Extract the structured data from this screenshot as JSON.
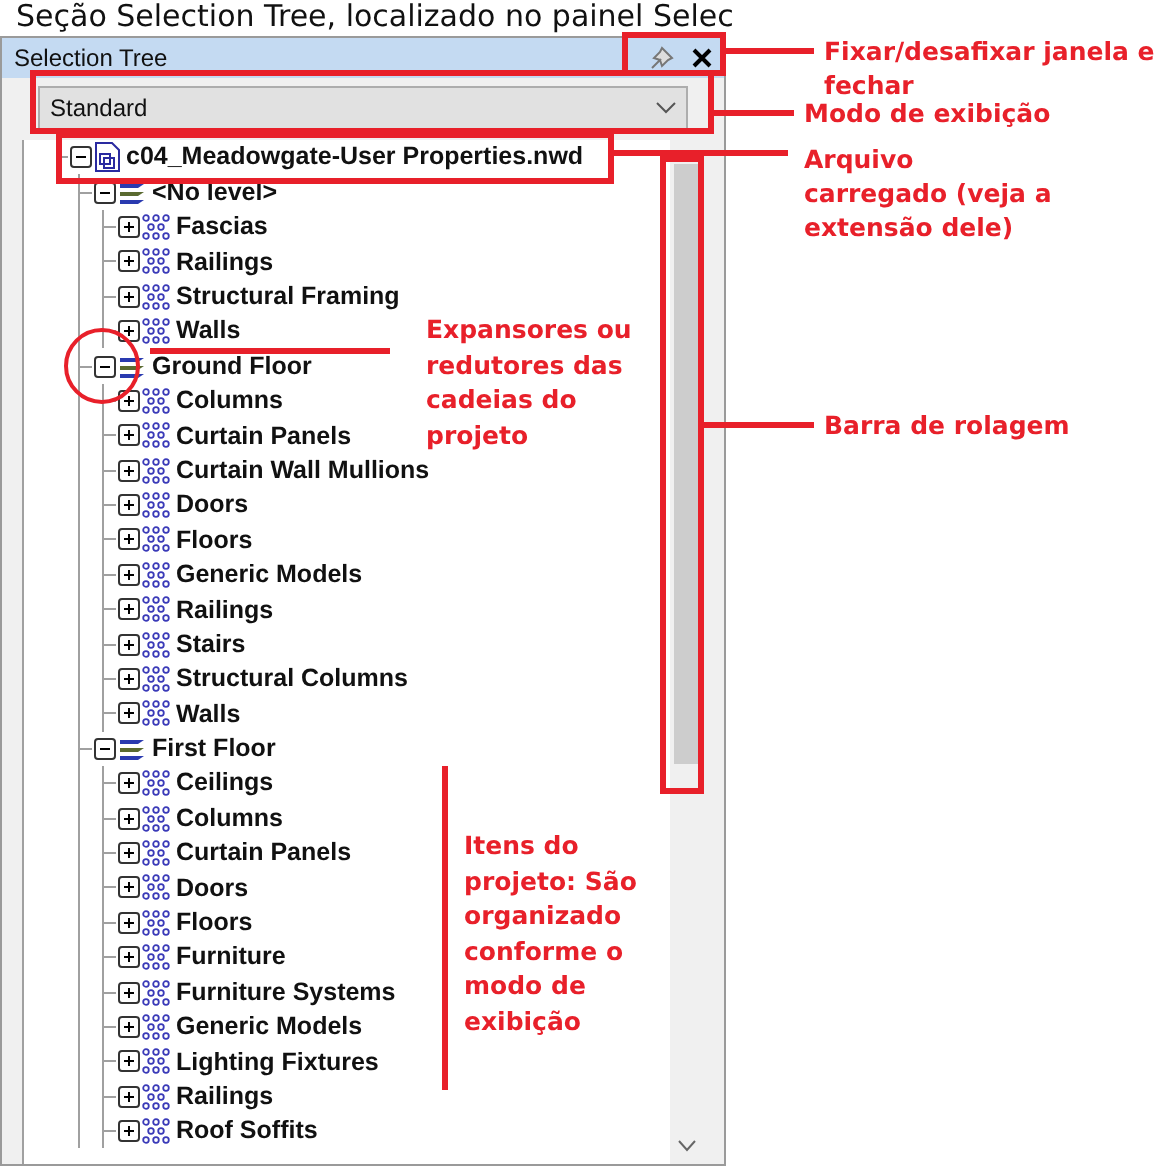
{
  "caption": "Seção Selection Tree, localizado no painel Selec",
  "panel": {
    "title": "Selection Tree",
    "dropdown": {
      "value": "Standard"
    },
    "tree": [
      {
        "label": "c04_Meadowgate-User Properties.nwd",
        "kind": "file",
        "expanded": true,
        "children": [
          {
            "label": "<No level>",
            "kind": "level",
            "expanded": true,
            "children": [
              {
                "label": "Fascias",
                "kind": "category",
                "expanded": false
              },
              {
                "label": "Railings",
                "kind": "category",
                "expanded": false
              },
              {
                "label": "Structural Framing",
                "kind": "category",
                "expanded": false
              },
              {
                "label": "Walls",
                "kind": "category",
                "expanded": false
              }
            ]
          },
          {
            "label": "Ground Floor",
            "kind": "level",
            "expanded": true,
            "children": [
              {
                "label": "Columns",
                "kind": "category",
                "expanded": false
              },
              {
                "label": "Curtain Panels",
                "kind": "category",
                "expanded": false
              },
              {
                "label": "Curtain Wall Mullions",
                "kind": "category",
                "expanded": false
              },
              {
                "label": "Doors",
                "kind": "category",
                "expanded": false
              },
              {
                "label": "Floors",
                "kind": "category",
                "expanded": false
              },
              {
                "label": "Generic Models",
                "kind": "category",
                "expanded": false
              },
              {
                "label": "Railings",
                "kind": "category",
                "expanded": false
              },
              {
                "label": "Stairs",
                "kind": "category",
                "expanded": false
              },
              {
                "label": "Structural Columns",
                "kind": "category",
                "expanded": false
              },
              {
                "label": "Walls",
                "kind": "category",
                "expanded": false
              }
            ]
          },
          {
            "label": "First Floor",
            "kind": "level",
            "expanded": true,
            "children": [
              {
                "label": "Ceilings",
                "kind": "category",
                "expanded": false
              },
              {
                "label": "Columns",
                "kind": "category",
                "expanded": false
              },
              {
                "label": "Curtain Panels",
                "kind": "category",
                "expanded": false
              },
              {
                "label": "Doors",
                "kind": "category",
                "expanded": false
              },
              {
                "label": "Floors",
                "kind": "category",
                "expanded": false
              },
              {
                "label": "Furniture",
                "kind": "category",
                "expanded": false
              },
              {
                "label": "Furniture Systems",
                "kind": "category",
                "expanded": false
              },
              {
                "label": "Generic Models",
                "kind": "category",
                "expanded": false
              },
              {
                "label": "Lighting Fixtures",
                "kind": "category",
                "expanded": false
              },
              {
                "label": "Railings",
                "kind": "category",
                "expanded": false
              },
              {
                "label": "Roof Soffits",
                "kind": "category",
                "expanded": false
              }
            ]
          }
        ]
      }
    ]
  },
  "annotations": [
    "Fixar/desafixar janela e fechar",
    "Modo de exibição",
    "Arquivo carregado (veja a extensão dele)",
    "Expansores ou redutores das cadeias do projeto",
    "Barra de rolagem",
    "Itens do projeto: São organizado conforme o modo de exibição"
  ]
}
